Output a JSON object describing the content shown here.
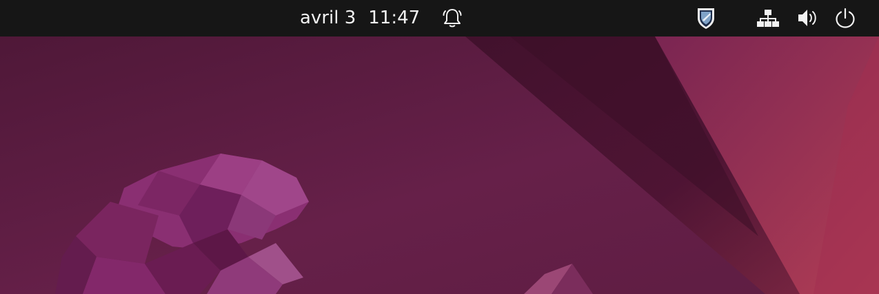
{
  "top_bar": {
    "date": "avril 3",
    "time": "11:47",
    "icons": [
      "notification-bell-icon",
      "security-shield-icon",
      "network-icon",
      "volume-icon",
      "power-icon"
    ]
  },
  "colors": {
    "panel": "#161616",
    "panel_text": "#f2f2f2",
    "wallpaper_base": "#5a1c40",
    "wallpaper_accent": "#a8335a"
  }
}
